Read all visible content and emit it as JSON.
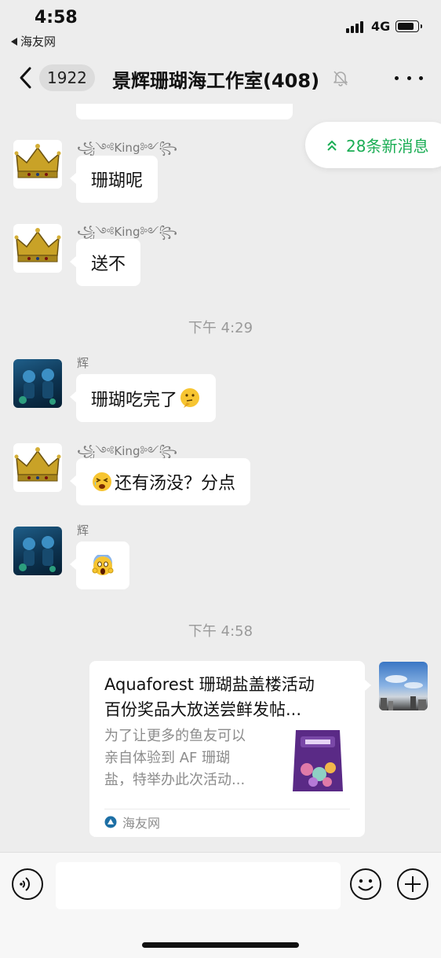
{
  "status_bar": {
    "time": "4:58",
    "back_app": "海友网",
    "network": "4G"
  },
  "header": {
    "unread_count": "1922",
    "title": "景辉珊瑚海工作室(408)"
  },
  "new_messages_pill": {
    "label": "28条新消息"
  },
  "messages": [
    {
      "sender": "꧁༺King༻꧂",
      "text": "珊瑚呢",
      "avatar": "crown-avatar"
    },
    {
      "sender": "꧁༺King༻꧂",
      "text": "送不",
      "avatar": "crown-avatar"
    },
    {
      "timestamp": "下午 4:29"
    },
    {
      "sender": "辉",
      "text": "珊瑚吃完了",
      "emoji": "thinking-face",
      "avatar": "diver-avatar"
    },
    {
      "sender": "꧁༺King༻꧂",
      "text": "还有汤没？分点",
      "emoji": "tired-face",
      "avatar": "crown-avatar"
    },
    {
      "sender": "辉",
      "text": "",
      "emoji": "screaming-face",
      "avatar": "diver-avatar"
    },
    {
      "timestamp": "下午 4:58"
    }
  ],
  "link_card": {
    "title_line1": "Aquaforest 珊瑚盐盖楼活动",
    "title_line2": "百份奖品大放送尝鲜发帖...",
    "desc_line1": "为了让更多的鱼友可以",
    "desc_line2": "亲自体验到 AF 珊瑚",
    "desc_line3": "盐，特举办此次活动...",
    "source": "海友网",
    "thumbnail": "salt-bag-image"
  },
  "colors": {
    "background": "#ededed",
    "bubble": "#ffffff",
    "accent_green": "#1aad54",
    "timestamp": "#9a9a9a"
  }
}
